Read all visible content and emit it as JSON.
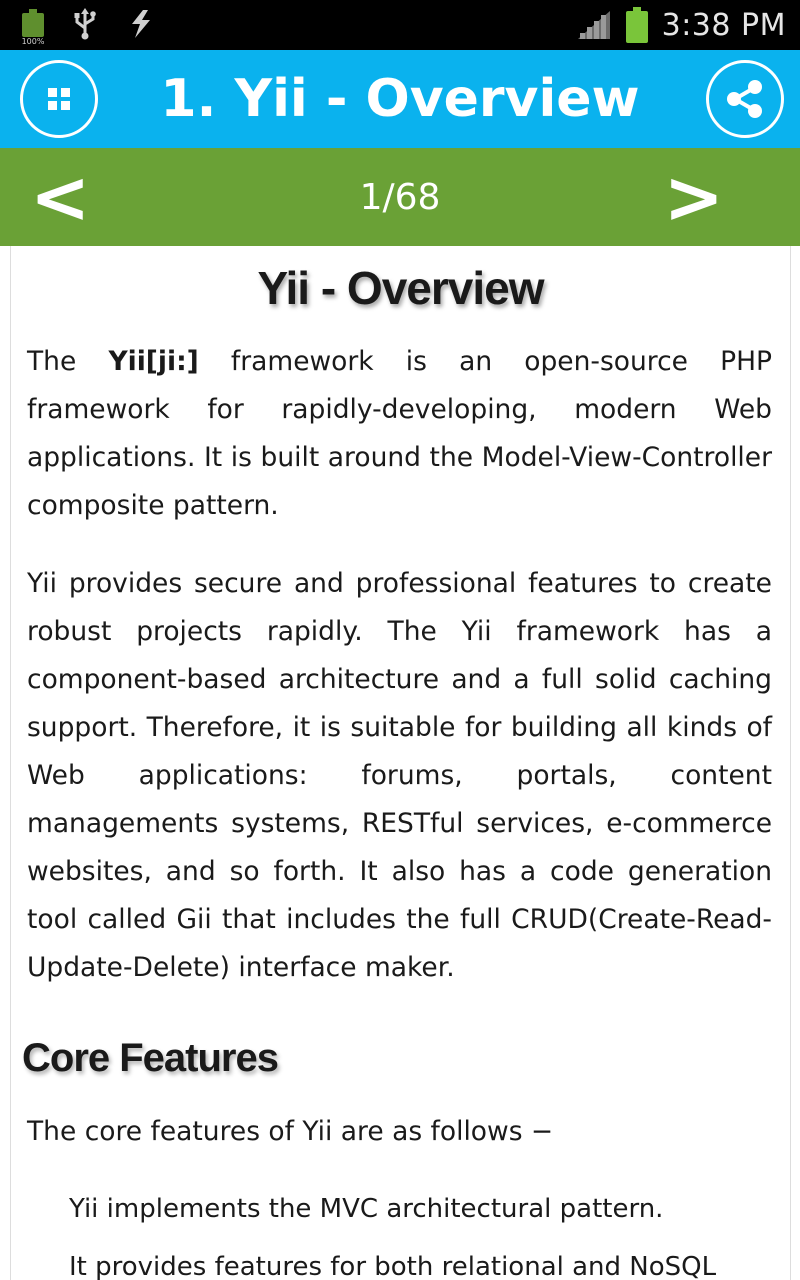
{
  "status_bar": {
    "battery_percent_label": "100%",
    "time": "3:38 PM"
  },
  "header": {
    "title": "1. Yii - Overview",
    "menu_icon": "grid-icon",
    "share_icon": "share-icon"
  },
  "nav": {
    "prev_label": "<",
    "next_label": ">",
    "page_counter": "1/68"
  },
  "content": {
    "heading": "Yii - Overview",
    "p1_start": "The ",
    "p1_bold": "Yii[ji:]",
    "p1_rest": " framework is an open-source PHP framework for rapidly-developing, modern Web applications. It is built around the Model-View-Controller composite pattern.",
    "p2": "Yii provides secure and professional features to create robust projects rapidly. The Yii framework has a component-based architecture and a full solid caching support. Therefore, it is suitable for building all kinds of Web applications: forums, portals, content managements systems, RESTful services, e-commerce websites, and so forth. It also has a code generation tool called Gii that includes the full CRUD(Create-Read-Update-Delete) interface maker.",
    "subheading": "Core Features",
    "p3": "The core features of Yii are as follows −",
    "list_items": [
      "Yii implements the MVC architectural pattern.",
      "It provides features for both relational and NoSQL"
    ]
  },
  "colors": {
    "title_bar": "#0ab2ee",
    "nav_bar": "#6aa136",
    "status_bar": "#000000"
  }
}
